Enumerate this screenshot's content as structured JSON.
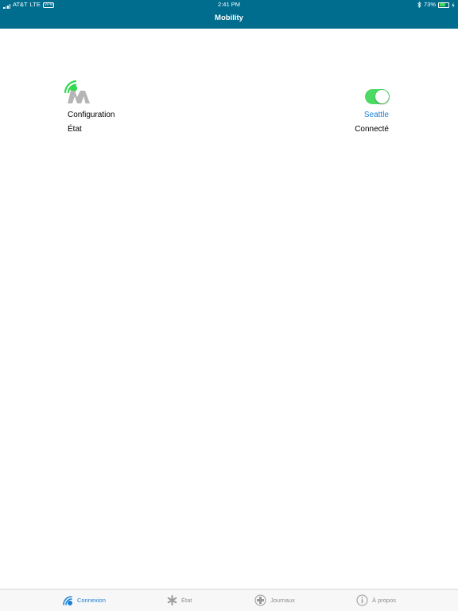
{
  "status_bar": {
    "carrier": "AT&T",
    "network": "LTE",
    "vpn": "VPN",
    "time": "2:41 PM",
    "battery": "73%",
    "battery_level": 0.73
  },
  "nav": {
    "title": "Mobility"
  },
  "connection": {
    "enabled": true,
    "rows": [
      {
        "label": "Configuration",
        "value": "Seattle"
      },
      {
        "label": "État",
        "value": "Connecté"
      }
    ]
  },
  "tabs": [
    {
      "label": "Connexion",
      "icon": "connexion-icon",
      "active": true
    },
    {
      "label": "État",
      "icon": "asterisk-icon",
      "active": false
    },
    {
      "label": "Journaux",
      "icon": "plus-circle-icon",
      "active": false
    },
    {
      "label": "À propos",
      "icon": "info-icon",
      "active": false
    }
  ],
  "colors": {
    "header": "#006d8f",
    "toggle_on": "#4cd964",
    "link": "#1b7fd6",
    "logo_green": "#32d84e",
    "logo_gray": "#b5b5b5"
  }
}
